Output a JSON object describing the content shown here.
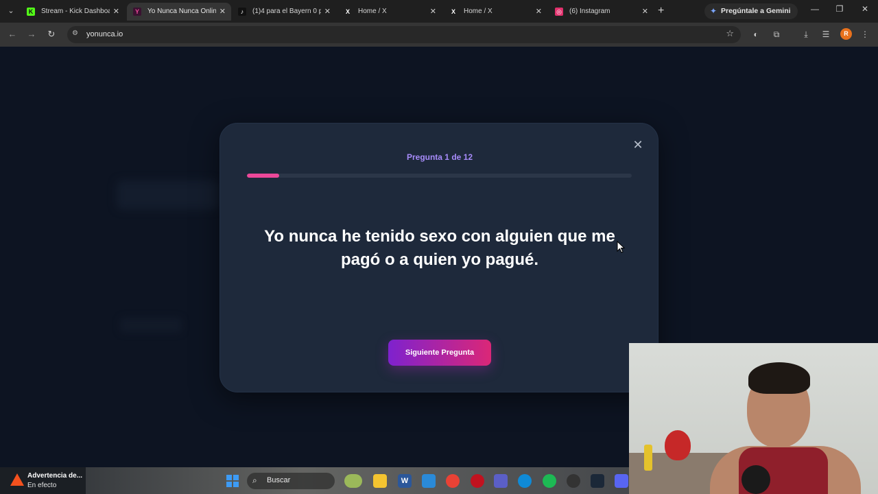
{
  "browser": {
    "tabs": [
      {
        "title": "Stream - Kick Dashboard",
        "favicon": "K",
        "color": "#53fc18"
      },
      {
        "title": "Yo Nunca Nunca Online",
        "favicon": "Y",
        "color": "#ec4899",
        "active": true
      },
      {
        "title": "(1)4 para el Bayern 0 p",
        "favicon": "♪",
        "color": "#ffffff"
      },
      {
        "title": "Home / X",
        "favicon": "X",
        "color": "#ffffff"
      },
      {
        "title": "Home / X",
        "favicon": "X",
        "color": "#ffffff"
      },
      {
        "title": "(6) Instagram",
        "favicon": "◎",
        "color": "#e1306c"
      }
    ],
    "gemini_label": "Pregúntale a Gemini",
    "url": "yonunca.io",
    "profile_initial": "R"
  },
  "modal": {
    "counter": "Pregunta 1 de 12",
    "current_question": 1,
    "total_questions": 12,
    "question": "Yo nunca he tenido sexo con alguien que me pagó o a quien yo pagué.",
    "next_button": "Siguiente Pregunta",
    "progress_color": "#ec4899"
  },
  "taskbar": {
    "warning_title": "Advertencia de...",
    "warning_sub": "En efecto",
    "search_placeholder": "Buscar"
  },
  "colors": {
    "accent_purple": "#7e22ce",
    "accent_pink": "#db2777",
    "counter_text": "#a78bfa",
    "modal_bg": "#1e293b"
  }
}
